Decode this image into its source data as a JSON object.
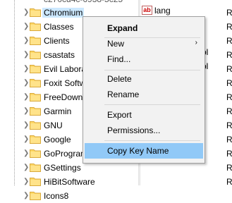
{
  "top_partial_key": "c270cd4c-6938-5c25",
  "tree": [
    {
      "label": "Chromium",
      "selected": true
    },
    {
      "label": "Classes"
    },
    {
      "label": "Clients"
    },
    {
      "label": "csastats"
    },
    {
      "label": "Evil Labora"
    },
    {
      "label": "Foxit Softw"
    },
    {
      "label": "FreeDown"
    },
    {
      "label": "Garmin"
    },
    {
      "label": "GNU"
    },
    {
      "label": "Google"
    },
    {
      "label": "GoProgram"
    },
    {
      "label": "GSettings"
    },
    {
      "label": "HiBitSoftware"
    },
    {
      "label": "Icons8"
    }
  ],
  "right_pane": {
    "value_name": "lang",
    "type_initials": [
      "R",
      "R",
      "R",
      "R",
      "R",
      "R",
      "R",
      "R",
      "R",
      "R",
      "R",
      "R",
      "R"
    ],
    "truncated_bits": [
      "bl",
      "bl"
    ],
    "ab_icon": "ab"
  },
  "context_menu": {
    "items": [
      {
        "label": "Expand",
        "bold": true
      },
      {
        "label": "New",
        "submenu": true,
        "arrow": "›"
      },
      {
        "label": "Find..."
      },
      {
        "label": "Delete"
      },
      {
        "label": "Rename"
      },
      {
        "label": "Export"
      },
      {
        "label": "Permissions..."
      },
      {
        "label": "Copy Key Name",
        "highlighted": true
      }
    ]
  },
  "icons": {
    "folder": "folder-icon",
    "chevron": "chevron-right-icon",
    "string_value": "string-value-icon"
  },
  "colors": {
    "selection": "#cce8ff",
    "menu_highlight": "#91c9f7",
    "folder_fill": "#ffd867",
    "menu_bg": "#f2f2f2"
  }
}
